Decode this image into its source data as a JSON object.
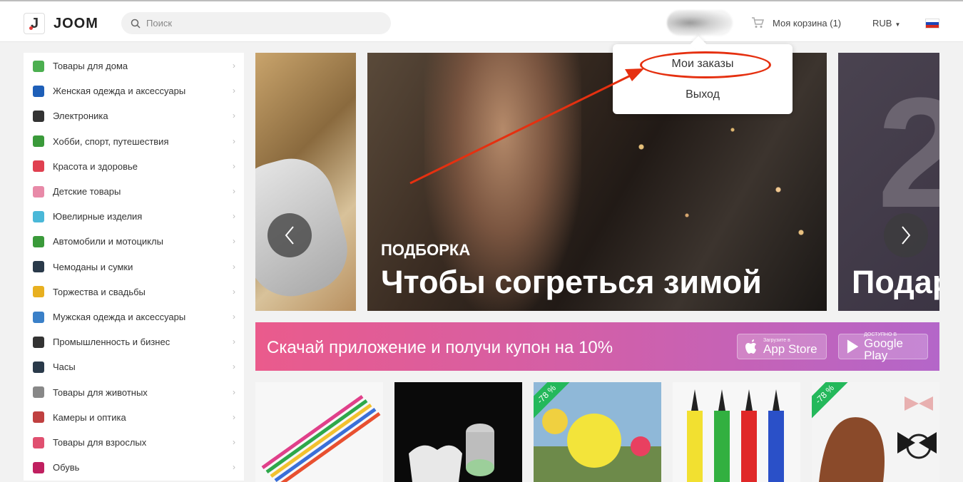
{
  "header": {
    "logo_text": "JOOM",
    "search_placeholder": "Поиск",
    "cart_label": "Моя корзина (1)",
    "currency": "RUB"
  },
  "user_menu": {
    "items": [
      "Мои заказы",
      "Выход"
    ]
  },
  "sidebar": {
    "categories": [
      {
        "label": "Товары для дома",
        "icon": "house-icon"
      },
      {
        "label": "Женская одежда и аксессуары",
        "icon": "dress-icon"
      },
      {
        "label": "Электроника",
        "icon": "headphones-icon"
      },
      {
        "label": "Хобби, спорт, путешествия",
        "icon": "bicycle-icon"
      },
      {
        "label": "Красота и здоровье",
        "icon": "lipstick-icon"
      },
      {
        "label": "Детские товары",
        "icon": "pacifier-icon"
      },
      {
        "label": "Ювелирные изделия",
        "icon": "diamond-icon"
      },
      {
        "label": "Автомобили и мотоциклы",
        "icon": "car-icon"
      },
      {
        "label": "Чемоданы и сумки",
        "icon": "suitcase-icon"
      },
      {
        "label": "Торжества и свадьбы",
        "icon": "ring-icon"
      },
      {
        "label": "Мужская одежда и аксессуары",
        "icon": "shirt-icon"
      },
      {
        "label": "Промышленность и бизнес",
        "icon": "factory-icon"
      },
      {
        "label": "Часы",
        "icon": "watch-icon"
      },
      {
        "label": "Товары для животных",
        "icon": "dog-icon"
      },
      {
        "label": "Камеры и оптика",
        "icon": "camera-icon"
      },
      {
        "label": "Товары для взрослых",
        "icon": "gender-icon"
      },
      {
        "label": "Обувь",
        "icon": "shoe-icon"
      }
    ]
  },
  "carousel": {
    "main_kicker": "ПОДБОРКА",
    "main_title": "Чтобы согреться зимой",
    "next_title": "Подар"
  },
  "promo": {
    "text": "Скачай приложение и получи купон на 10%",
    "app_store_small": "Загрузите в",
    "app_store_name": "App Store",
    "google_small": "ДОСТУПНО В",
    "google_name": "Google Play"
  },
  "products": {
    "discount_badge": "-78 %"
  },
  "colors": {
    "accent_red": "#e53010",
    "promo_start": "#ea5b8c",
    "promo_end": "#b466c9",
    "discount_green": "#24b85b"
  }
}
